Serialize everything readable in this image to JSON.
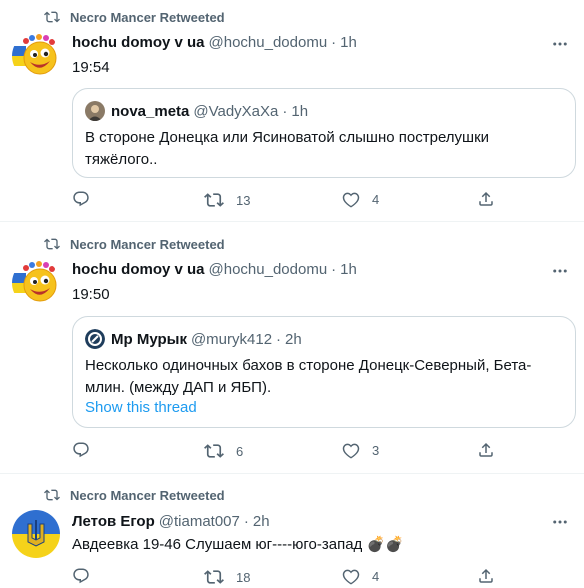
{
  "tweets": [
    {
      "retweeted_by": "Necro Mancer Retweeted",
      "name": "hochu domoy v ua",
      "handle": "@hochu_dodomu",
      "time": "1h",
      "text": "19:54",
      "quote": {
        "name": "nova_meta",
        "handle": "@VadyXaXa",
        "time": "1h",
        "text": "В стороне Донецка или Ясиноватой слышно пострелушки тяжёлого.."
      },
      "replies": "",
      "retweets": "13",
      "likes": "4"
    },
    {
      "retweeted_by": "Necro Mancer Retweeted",
      "name": "hochu domoy v ua",
      "handle": "@hochu_dodomu",
      "time": "1h",
      "text": "19:50",
      "quote": {
        "name": "Мр Мурык",
        "handle": "@muryk412",
        "time": "2h",
        "text": "Несколько одиночных бахов в стороне Донецк-Северный, Бета-млин. (между ДАП и ЯБП).",
        "link": "Show this thread"
      },
      "replies": "",
      "retweets": "6",
      "likes": "3"
    },
    {
      "retweeted_by": "Necro Mancer Retweeted",
      "name": "Летов Егор",
      "handle": "@tiamat007",
      "time": "2h",
      "text": "Авдеевка 19-46 Слушаем юг----юго-запад 💣💣",
      "replies": "",
      "retweets": "18",
      "likes": "4"
    }
  ],
  "colors": {
    "text": "#0f1419",
    "secondary": "#536471",
    "link": "#1d9bf0",
    "border": "#cfd9de"
  }
}
